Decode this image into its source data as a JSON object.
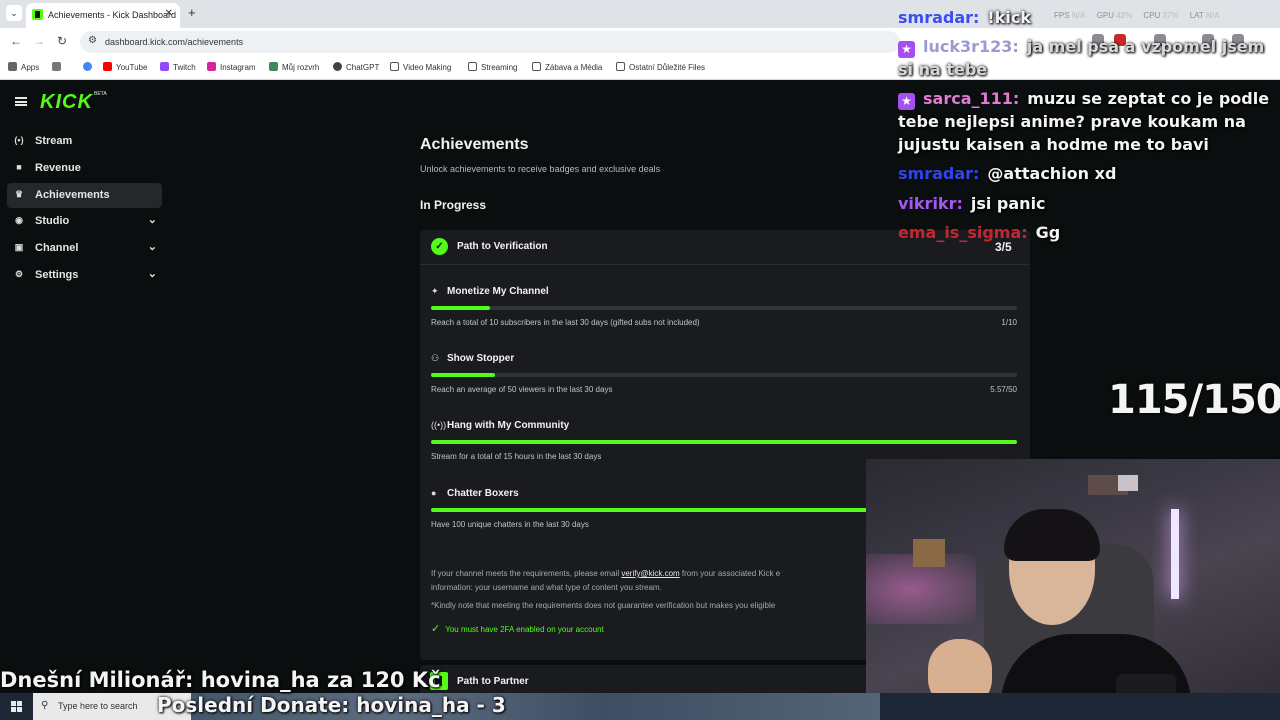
{
  "browser": {
    "tab_title": "Achievements - Kick Dashboard",
    "url": "dashboard.kick.com/achievements",
    "bookmarks": [
      "Apps",
      "YouTube",
      "Twitch",
      "Instagram",
      "Můj rozvrh",
      "ChatGPT",
      "Video Making",
      "Streaming",
      "Zábava a Média",
      "Ostatní Důležité Files"
    ]
  },
  "kick": {
    "logo": "KICK",
    "beta": "BETA",
    "nav": [
      {
        "label": "Stream",
        "icon": "stream-icon"
      },
      {
        "label": "Revenue",
        "icon": "revenue-icon"
      },
      {
        "label": "Achievements",
        "icon": "trophy-icon",
        "active": true
      },
      {
        "label": "Studio",
        "icon": "studio-icon"
      },
      {
        "label": "Channel",
        "icon": "channel-icon"
      },
      {
        "label": "Settings",
        "icon": "gear-icon"
      }
    ],
    "title": "Achievements",
    "subtitle": "Unlock achievements to receive badges and exclusive deals",
    "section": "In Progress",
    "card": {
      "title": "Path to Verification",
      "count": "3/5",
      "requirements": [
        {
          "name": "Monetize My Channel",
          "desc": "Reach a total of 10 subscribers in the last 30 days (gifted subs not included)",
          "progress_text": "1/10",
          "progress": 0.1
        },
        {
          "name": "Show Stopper",
          "desc": "Reach an average of 50 viewers in the last 30 days",
          "progress_text": "5.57/50",
          "progress": 0.11
        },
        {
          "name": "Hang with My Community",
          "desc": "Stream for a total of 15 hours in the last 30 days",
          "progress_text": "",
          "progress": 1.0
        },
        {
          "name": "Chatter Boxers",
          "desc": "Have 100 unique chatters in the last 30 days",
          "progress_text": "",
          "progress": 1.0
        }
      ],
      "note_prefix": "If your channel meets the requirements, please email ",
      "note_link": "verify@kick.com",
      "note_suffix": " from your associated Kick e",
      "note_line2": "information: your username and what type of content you stream.",
      "note_line3": "*Kindly note that meeting the requirements does not guarantee verification but makes you eligible",
      "twofa": "You must have 2FA enabled on your account"
    },
    "card2_title": "Path to Partner"
  },
  "overlay": {
    "stats": [
      {
        "label": "FPS",
        "value": "N/A"
      },
      {
        "label": "GPU",
        "value": "42%"
      },
      {
        "label": "CPU",
        "value": "37%"
      },
      {
        "label": "LAT",
        "value": "N/A"
      }
    ],
    "chat": [
      {
        "user": "smradar:",
        "text": "!kick",
        "color": "#3b4df5",
        "badge": false
      },
      {
        "user": "luck3r123:",
        "text": "ja mel psa a vzpomel jsem si na tebe",
        "color": "#9a9bd0",
        "badge": true
      },
      {
        "user": "sarca_111:",
        "text": "muzu se zeptat co je podle tebe nejlepsi anime? prave koukam na jujustu kaisen a hodme me to bavi",
        "color": "#e07ad3",
        "badge": true
      },
      {
        "user": "smradar:",
        "text": "@attachion xd",
        "color": "#2f44f0",
        "badge": false
      },
      {
        "user": "vikrikr:",
        "text": "jsi panic",
        "color": "#a557f2",
        "badge": false
      },
      {
        "user": "ema_is_sigma:",
        "text": "Gg",
        "color": "#c0282f",
        "badge": false
      }
    ],
    "counter": "115/150",
    "millionaire": "Dnešní Milionář: hovina_ha za 120 Kč",
    "last_donate": "Poslední Donate: hovina_ha - 3"
  },
  "taskbar": {
    "search_placeholder": "Type here to search"
  },
  "colors": {
    "accent": "#53fc18",
    "bg": "#0b0e0f",
    "card": "#191b1f"
  }
}
